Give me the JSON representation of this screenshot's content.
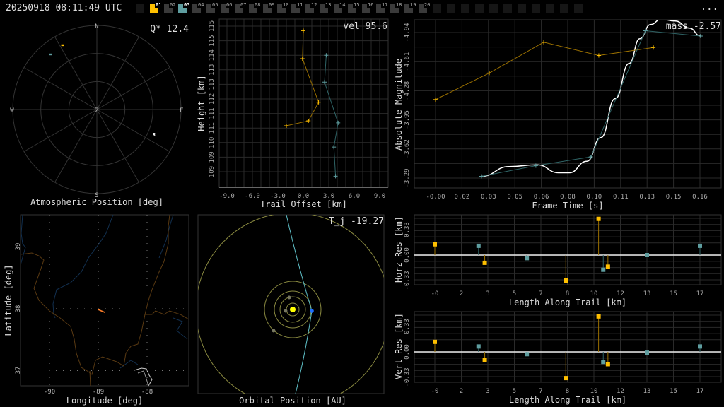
{
  "header": {
    "timestamp": "20250918 08:11:49 UTC",
    "more_label": "...",
    "tabs": [
      {
        "label": "",
        "state": "empty"
      },
      {
        "label": "01",
        "state": "active",
        "color": "#ffc000"
      },
      {
        "label": "02",
        "state": "normal"
      },
      {
        "label": "03",
        "state": "active",
        "color": "#5f9ea0"
      },
      {
        "label": "04",
        "state": "normal"
      },
      {
        "label": "05",
        "state": "normal"
      },
      {
        "label": "06",
        "state": "normal"
      },
      {
        "label": "07",
        "state": "normal"
      },
      {
        "label": "08",
        "state": "normal"
      },
      {
        "label": "09",
        "state": "normal"
      },
      {
        "label": "10",
        "state": "normal"
      },
      {
        "label": "11",
        "state": "normal"
      },
      {
        "label": "12",
        "state": "normal"
      },
      {
        "label": "13",
        "state": "normal"
      },
      {
        "label": "14",
        "state": "normal"
      },
      {
        "label": "15",
        "state": "normal"
      },
      {
        "label": "16",
        "state": "normal"
      },
      {
        "label": "17",
        "state": "normal"
      },
      {
        "label": "18",
        "state": "normal"
      },
      {
        "label": "19",
        "state": "normal"
      },
      {
        "label": "20",
        "state": "normal"
      },
      {
        "label": "",
        "state": "empty"
      },
      {
        "label": "",
        "state": "empty"
      },
      {
        "label": "",
        "state": "empty"
      },
      {
        "label": "",
        "state": "empty"
      },
      {
        "label": "",
        "state": "empty"
      },
      {
        "label": "",
        "state": "empty"
      },
      {
        "label": "",
        "state": "empty"
      },
      {
        "label": "",
        "state": "empty"
      },
      {
        "label": "",
        "state": "empty"
      },
      {
        "label": "",
        "state": "empty"
      },
      {
        "label": "",
        "state": "empty"
      }
    ]
  },
  "colors": {
    "station1": "#ffc000",
    "station2": "#5f9ea0",
    "fit": "#ffffff",
    "grid": "#2a2a2a",
    "state_border": "#5a3a12",
    "river": "#123050",
    "orbit": "#8a8a40",
    "sun": "#ffff00",
    "earth": "#1e6fff",
    "track": "#ff7f2a"
  },
  "sky": {
    "annotation": "Q* 12.4",
    "title": "Atmospheric Position [deg]",
    "cardinals": {
      "n": "N",
      "s": "S",
      "e": "E",
      "w": "W",
      "z": "Z"
    },
    "radiant_label": "R",
    "points": [
      {
        "station": "01",
        "az": 332,
        "alt": 12
      },
      {
        "station": "03",
        "az": 320,
        "alt": 13
      }
    ],
    "radiant": {
      "az": 113,
      "alt": 23
    }
  },
  "chart_data": [
    {
      "id": "height",
      "type": "line",
      "annotation": "vel 95.6",
      "xlabel": "Trail Offset [km]",
      "ylabel": "Height [km]",
      "xticks": [
        "-9.0",
        "-6.0",
        "-3.0",
        "0.0",
        "3.0",
        "6.0",
        "9.0"
      ],
      "yticks": [
        "109",
        "109",
        "110",
        "111",
        "111",
        "112",
        "113",
        "113",
        "114",
        "115",
        "115"
      ],
      "grid": true,
      "series": [
        {
          "station": "01",
          "x": [
            0.0,
            -0.1,
            1.8,
            0.6,
            -2.0
          ],
          "y": [
            115.0,
            113.75,
            111.8,
            110.97,
            110.75
          ]
        },
        {
          "station": "03",
          "x": [
            2.7,
            2.5,
            4.1,
            3.6,
            3.8
          ],
          "y": [
            113.9,
            112.7,
            110.88,
            109.8,
            108.5
          ]
        }
      ]
    },
    {
      "id": "magnitude",
      "type": "line",
      "annotation": "mass -2.57",
      "xlabel": "Frame Time [s]",
      "ylabel": "Absolute Magnitude",
      "xticks": [
        "-0.00",
        "0.02",
        "0.03",
        "0.05",
        "0.06",
        "0.08",
        "0.10",
        "0.11",
        "0.13",
        "0.15",
        "0.16"
      ],
      "yticks": [
        "-4.94",
        "-4.61",
        "-4.28",
        "-3.95",
        "-3.62",
        "-3.29"
      ],
      "grid": true,
      "series": [
        {
          "station": "01",
          "x": [
            0.0,
            0.0325,
            0.0655,
            0.0988,
            0.1318
          ],
          "y": [
            -4.18,
            -4.48,
            -4.83,
            -4.68,
            -4.77
          ]
        },
        {
          "station": "03",
          "x": [
            0.0278,
            0.0607,
            0.094,
            0.127,
            0.1604
          ],
          "y": [
            -3.31,
            -3.43,
            -3.53,
            -4.96,
            -4.9
          ]
        }
      ],
      "fit": {
        "x": [
          0.0278,
          0.0445,
          0.0616,
          0.0744,
          0.0809,
          0.0916,
          0.1001,
          0.1087,
          0.1172,
          0.1236,
          0.1301,
          0.1365,
          0.145,
          0.1536,
          0.1604
        ],
        "y": [
          -3.31,
          -3.42,
          -3.44,
          -3.35,
          -3.35,
          -3.48,
          -3.75,
          -4.19,
          -4.59,
          -4.87,
          -5.03,
          -5.09,
          -5.07,
          -4.99,
          -4.9
        ]
      }
    },
    {
      "id": "horz-res",
      "type": "scatter",
      "xlabel": "Length Along Trail [km]",
      "ylabel": "Horz Res [km]",
      "xticks": [
        "-0",
        "2",
        "3",
        "5",
        "7",
        "8",
        "10",
        "12",
        "13",
        "15",
        "17"
      ],
      "yticks": [
        "0.33",
        "0.00",
        "-0.33"
      ],
      "grid": true,
      "series": [
        {
          "station": "01",
          "x": [
            0,
            3.2,
            8.4,
            10.5,
            11.1
          ],
          "y": [
            0.14,
            -0.1,
            -0.33,
            0.47,
            -0.15
          ]
        },
        {
          "station": "03",
          "x": [
            2.8,
            5.9,
            10.8,
            13.6,
            17.0
          ],
          "y": [
            0.12,
            -0.04,
            -0.19,
            0.0,
            0.12
          ]
        }
      ]
    },
    {
      "id": "vert-res",
      "type": "scatter",
      "xlabel": "Length Along Trail [km]",
      "ylabel": "Vert Res [km]",
      "xticks": [
        "-0",
        "2",
        "3",
        "5",
        "7",
        "8",
        "10",
        "12",
        "13",
        "15",
        "17"
      ],
      "yticks": [
        "0.33",
        "0.00",
        "-0.33"
      ],
      "grid": true,
      "series": [
        {
          "station": "01",
          "x": [
            0,
            3.2,
            8.4,
            10.5,
            11.1
          ],
          "y": [
            0.13,
            -0.11,
            -0.34,
            0.46,
            -0.16
          ]
        },
        {
          "station": "03",
          "x": [
            2.8,
            5.9,
            10.8,
            13.6,
            17.0
          ],
          "y": [
            0.07,
            -0.03,
            -0.13,
            -0.01,
            0.07
          ]
        }
      ]
    }
  ],
  "map": {
    "xlabel": "Longitude [deg]",
    "ylabel": "Latitude [deg]",
    "xticks": [
      "-90",
      "-89",
      "-88"
    ],
    "yticks": [
      "39",
      "38",
      "37"
    ],
    "track": {
      "lon": [
        -89.01,
        -88.86
      ],
      "lat": [
        37.99,
        37.94
      ]
    }
  },
  "orbit": {
    "annotation": "T_j -19.27",
    "title": "Orbital Position [AU]"
  }
}
